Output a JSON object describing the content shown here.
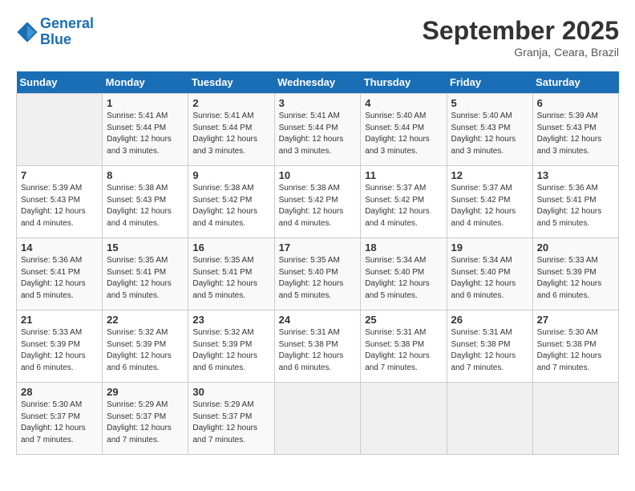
{
  "logo": {
    "line1": "General",
    "line2": "Blue"
  },
  "title": "September 2025",
  "location": "Granja, Ceara, Brazil",
  "days_of_week": [
    "Sunday",
    "Monday",
    "Tuesday",
    "Wednesday",
    "Thursday",
    "Friday",
    "Saturday"
  ],
  "weeks": [
    [
      {
        "day": "",
        "info": ""
      },
      {
        "day": "1",
        "info": "Sunrise: 5:41 AM\nSunset: 5:44 PM\nDaylight: 12 hours\nand 3 minutes."
      },
      {
        "day": "2",
        "info": "Sunrise: 5:41 AM\nSunset: 5:44 PM\nDaylight: 12 hours\nand 3 minutes."
      },
      {
        "day": "3",
        "info": "Sunrise: 5:41 AM\nSunset: 5:44 PM\nDaylight: 12 hours\nand 3 minutes."
      },
      {
        "day": "4",
        "info": "Sunrise: 5:40 AM\nSunset: 5:44 PM\nDaylight: 12 hours\nand 3 minutes."
      },
      {
        "day": "5",
        "info": "Sunrise: 5:40 AM\nSunset: 5:43 PM\nDaylight: 12 hours\nand 3 minutes."
      },
      {
        "day": "6",
        "info": "Sunrise: 5:39 AM\nSunset: 5:43 PM\nDaylight: 12 hours\nand 3 minutes."
      }
    ],
    [
      {
        "day": "7",
        "info": "Sunrise: 5:39 AM\nSunset: 5:43 PM\nDaylight: 12 hours\nand 4 minutes."
      },
      {
        "day": "8",
        "info": "Sunrise: 5:38 AM\nSunset: 5:43 PM\nDaylight: 12 hours\nand 4 minutes."
      },
      {
        "day": "9",
        "info": "Sunrise: 5:38 AM\nSunset: 5:42 PM\nDaylight: 12 hours\nand 4 minutes."
      },
      {
        "day": "10",
        "info": "Sunrise: 5:38 AM\nSunset: 5:42 PM\nDaylight: 12 hours\nand 4 minutes."
      },
      {
        "day": "11",
        "info": "Sunrise: 5:37 AM\nSunset: 5:42 PM\nDaylight: 12 hours\nand 4 minutes."
      },
      {
        "day": "12",
        "info": "Sunrise: 5:37 AM\nSunset: 5:42 PM\nDaylight: 12 hours\nand 4 minutes."
      },
      {
        "day": "13",
        "info": "Sunrise: 5:36 AM\nSunset: 5:41 PM\nDaylight: 12 hours\nand 5 minutes."
      }
    ],
    [
      {
        "day": "14",
        "info": "Sunrise: 5:36 AM\nSunset: 5:41 PM\nDaylight: 12 hours\nand 5 minutes."
      },
      {
        "day": "15",
        "info": "Sunrise: 5:35 AM\nSunset: 5:41 PM\nDaylight: 12 hours\nand 5 minutes."
      },
      {
        "day": "16",
        "info": "Sunrise: 5:35 AM\nSunset: 5:41 PM\nDaylight: 12 hours\nand 5 minutes."
      },
      {
        "day": "17",
        "info": "Sunrise: 5:35 AM\nSunset: 5:40 PM\nDaylight: 12 hours\nand 5 minutes."
      },
      {
        "day": "18",
        "info": "Sunrise: 5:34 AM\nSunset: 5:40 PM\nDaylight: 12 hours\nand 5 minutes."
      },
      {
        "day": "19",
        "info": "Sunrise: 5:34 AM\nSunset: 5:40 PM\nDaylight: 12 hours\nand 6 minutes."
      },
      {
        "day": "20",
        "info": "Sunrise: 5:33 AM\nSunset: 5:39 PM\nDaylight: 12 hours\nand 6 minutes."
      }
    ],
    [
      {
        "day": "21",
        "info": "Sunrise: 5:33 AM\nSunset: 5:39 PM\nDaylight: 12 hours\nand 6 minutes."
      },
      {
        "day": "22",
        "info": "Sunrise: 5:32 AM\nSunset: 5:39 PM\nDaylight: 12 hours\nand 6 minutes."
      },
      {
        "day": "23",
        "info": "Sunrise: 5:32 AM\nSunset: 5:39 PM\nDaylight: 12 hours\nand 6 minutes."
      },
      {
        "day": "24",
        "info": "Sunrise: 5:31 AM\nSunset: 5:38 PM\nDaylight: 12 hours\nand 6 minutes."
      },
      {
        "day": "25",
        "info": "Sunrise: 5:31 AM\nSunset: 5:38 PM\nDaylight: 12 hours\nand 7 minutes."
      },
      {
        "day": "26",
        "info": "Sunrise: 5:31 AM\nSunset: 5:38 PM\nDaylight: 12 hours\nand 7 minutes."
      },
      {
        "day": "27",
        "info": "Sunrise: 5:30 AM\nSunset: 5:38 PM\nDaylight: 12 hours\nand 7 minutes."
      }
    ],
    [
      {
        "day": "28",
        "info": "Sunrise: 5:30 AM\nSunset: 5:37 PM\nDaylight: 12 hours\nand 7 minutes."
      },
      {
        "day": "29",
        "info": "Sunrise: 5:29 AM\nSunset: 5:37 PM\nDaylight: 12 hours\nand 7 minutes."
      },
      {
        "day": "30",
        "info": "Sunrise: 5:29 AM\nSunset: 5:37 PM\nDaylight: 12 hours\nand 7 minutes."
      },
      {
        "day": "",
        "info": ""
      },
      {
        "day": "",
        "info": ""
      },
      {
        "day": "",
        "info": ""
      },
      {
        "day": "",
        "info": ""
      }
    ]
  ]
}
